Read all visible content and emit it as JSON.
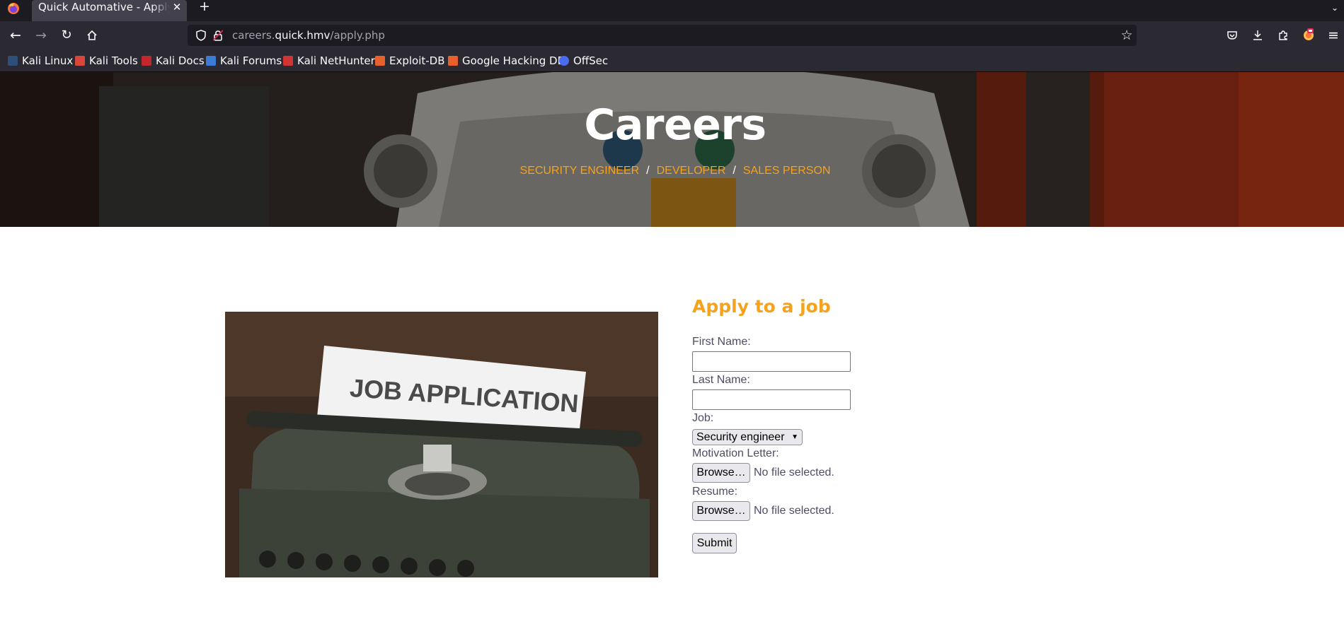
{
  "browser": {
    "tab_title": "Quick Automative - Apply to a job",
    "url_host_prefix": "careers.",
    "url_host": "quick.hmv",
    "url_path": "/apply.php",
    "accent": "#f7a21b"
  },
  "bookmarks": [
    {
      "label": "Kali Linux",
      "icon": "kali-dragon-icon"
    },
    {
      "label": "Kali Tools",
      "icon": "kali-tools-icon"
    },
    {
      "label": "Kali Docs",
      "icon": "kali-docs-icon"
    },
    {
      "label": "Kali Forums",
      "icon": "kali-forums-icon"
    },
    {
      "label": "Kali NetHunter",
      "icon": "kali-nethunter-icon"
    },
    {
      "label": "Exploit-DB",
      "icon": "exploit-db-icon"
    },
    {
      "label": "Google Hacking DB",
      "icon": "ghdb-icon"
    },
    {
      "label": "OffSec",
      "icon": "offsec-icon"
    }
  ],
  "hero": {
    "title": "Careers",
    "links": [
      "SECURITY ENGINEER",
      "DEVELOPER",
      "SALES PERSON"
    ],
    "separator": "/"
  },
  "image": {
    "paper_text": "JOB APPLICATION"
  },
  "form": {
    "title": "Apply to a job",
    "first_name_label": "First Name:",
    "first_name_value": "",
    "last_name_label": "Last Name:",
    "last_name_value": "",
    "job_label": "Job:",
    "job_selected": "Security engineer",
    "motivation_label": "Motivation Letter:",
    "resume_label": "Resume:",
    "browse_label": "Browse…",
    "no_file": "No file selected.",
    "submit_label": "Submit"
  }
}
